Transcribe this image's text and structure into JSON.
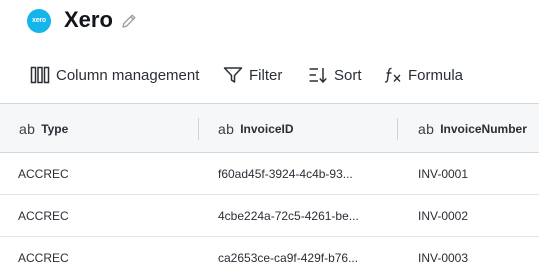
{
  "app": {
    "logo_text": "xero",
    "title": "Xero"
  },
  "toolbar": {
    "column_management": "Column management",
    "filter": "Filter",
    "sort": "Sort",
    "formula": "Formula"
  },
  "table": {
    "type_glyph": "ab",
    "columns": [
      "Type",
      "InvoiceID",
      "InvoiceNumber"
    ],
    "rows": [
      [
        "ACCREC",
        "f60ad45f-3924-4c4b-93...",
        "INV-0001"
      ],
      [
        "ACCREC",
        "4cbe224a-72c5-4261-be...",
        "INV-0002"
      ],
      [
        "ACCREC",
        "ca2653ce-ca9f-429f-b76...",
        "INV-0003"
      ]
    ]
  },
  "colors": {
    "logo": "#13b5ea",
    "header_bg": "#f6f7f8",
    "border": "#d4d8dd"
  },
  "icons": [
    "xero-logo-icon",
    "edit-pencil-icon",
    "columns-icon",
    "filter-icon",
    "sort-icon",
    "formula-icon"
  ]
}
